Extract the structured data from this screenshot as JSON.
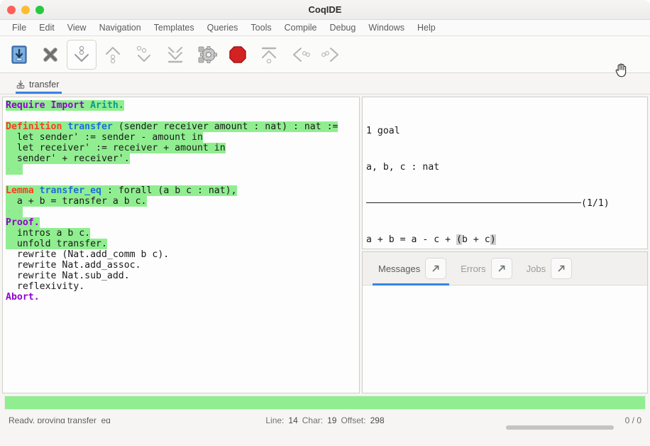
{
  "window": {
    "title": "CoqIDE",
    "controls": [
      "close",
      "minimize",
      "maximize"
    ]
  },
  "menubar": {
    "items": [
      "File",
      "Edit",
      "View",
      "Navigation",
      "Templates",
      "Queries",
      "Tools",
      "Compile",
      "Debug",
      "Windows",
      "Help"
    ]
  },
  "toolbar": {
    "buttons": [
      {
        "name": "save-icon",
        "title": "Save"
      },
      {
        "name": "close-document-icon",
        "title": "Close"
      },
      {
        "name": "forward-one-step-icon",
        "title": "Forward one step",
        "active": true
      },
      {
        "name": "backward-one-step-icon",
        "title": "Backward one step"
      },
      {
        "name": "go-to-cursor-icon",
        "title": "Go to cursor"
      },
      {
        "name": "go-to-end-icon",
        "title": "Go to end"
      },
      {
        "name": "compile-gears-icon",
        "title": "Compile"
      },
      {
        "name": "interrupt-stop-icon",
        "title": "Interrupt"
      },
      {
        "name": "restart-icon",
        "title": "Restart"
      },
      {
        "name": "previous-error-icon",
        "title": "Previous error"
      },
      {
        "name": "next-error-icon",
        "title": "Next error"
      }
    ]
  },
  "file_tabs": [
    {
      "label": "transfer",
      "icon": "save-document-icon",
      "selected": true
    }
  ],
  "editor": {
    "lines": [
      [
        {
          "t": "Require Import",
          "c": "kw-pur",
          "hl": true
        },
        {
          "t": " ",
          "c": "",
          "hl": true
        },
        {
          "t": "Arith.",
          "c": "id-teal",
          "hl": true
        }
      ],
      [],
      [
        {
          "t": "Definition",
          "c": "kw-red",
          "hl": true
        },
        {
          "t": " ",
          "c": "",
          "hl": true
        },
        {
          "t": "transfer",
          "c": "id-blue",
          "hl": true
        },
        {
          "t": " (sender receiver amount : nat) : nat :=",
          "c": "",
          "hl": true
        }
      ],
      [
        {
          "t": "  let sender' := sender - amount in",
          "c": "",
          "hl": true
        }
      ],
      [
        {
          "t": "  let receiver' := receiver + amount in",
          "c": "",
          "hl": true
        }
      ],
      [
        {
          "t": "  sender' + receiver'.",
          "c": "",
          "hl": true
        }
      ],
      [
        {
          "t": "· ·",
          "c": "dots",
          "hl": true
        }
      ],
      [],
      [
        {
          "t": "Lemma",
          "c": "kw-red",
          "hl": true
        },
        {
          "t": " ",
          "c": "",
          "hl": true
        },
        {
          "t": "transfer_eq",
          "c": "id-blue",
          "hl": true
        },
        {
          "t": " : forall (a b c : nat),",
          "c": "",
          "hl": true
        }
      ],
      [
        {
          "t": "  a + b = transfer a b c.",
          "c": "",
          "hl": true
        }
      ],
      [
        {
          "t": "· ·",
          "c": "dots",
          "hl": true
        }
      ],
      [
        {
          "t": "Proof.",
          "c": "kw-pur",
          "hl": true
        }
      ],
      [
        {
          "t": "  intros a b c.",
          "c": "",
          "hl": true
        }
      ],
      [
        {
          "t": "  unfold transfer.",
          "c": "",
          "hl": true
        }
      ],
      [
        {
          "t": "  rewrite (Nat.add_comm b c).",
          "c": "",
          "hl": false
        }
      ],
      [
        {
          "t": "  rewrite Nat.add_assoc.",
          "c": "",
          "hl": false
        }
      ],
      [
        {
          "t": "  rewrite Nat.sub_add.",
          "c": "",
          "hl": false
        }
      ],
      [
        {
          "t": "  reflexivity.",
          "c": "",
          "hl": false
        }
      ],
      [
        {
          "t": "Abort.",
          "c": "kw-pur",
          "hl": false
        }
      ]
    ]
  },
  "goal_panel": {
    "goal_count_text": "1 goal",
    "hypotheses": "a, b, c : nat",
    "goal_index": "(1/1)",
    "conclusion_prefix": "a + b = a - c + ",
    "conclusion_open_paren": "(",
    "conclusion_inner": "b + c",
    "conclusion_close_paren": ")"
  },
  "message_tabs": [
    {
      "label": "Messages",
      "selected": true,
      "detach_icon": "detach-arrow-icon"
    },
    {
      "label": "Errors",
      "selected": false,
      "detach_icon": "detach-arrow-icon"
    },
    {
      "label": "Jobs",
      "selected": false,
      "detach_icon": "detach-arrow-icon"
    }
  ],
  "messages_body": "",
  "progress": {
    "color": "#90ee90",
    "value_percent": 100
  },
  "statusbar": {
    "status_text": "Ready, proving transfer_eq",
    "line_label": "Line:",
    "line_value": "14",
    "char_label": "Char:",
    "char_value": "19",
    "offset_label": "Offset:",
    "offset_value": "298",
    "counter": "0 / 0"
  }
}
